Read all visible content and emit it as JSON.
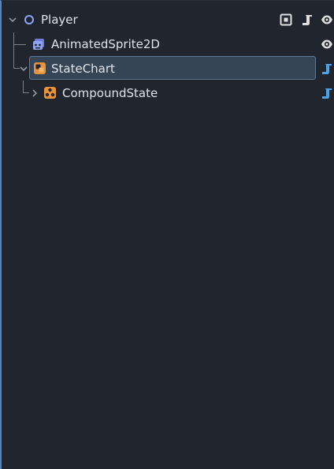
{
  "tree": {
    "nodes": [
      {
        "label": "Player",
        "icon": "node-circle-icon",
        "expanded": true
      },
      {
        "label": "AnimatedSprite2D",
        "icon": "animated-sprite-2d-icon"
      },
      {
        "label": "StateChart",
        "icon": "state-chart-icon",
        "expanded": true,
        "selected": true
      },
      {
        "label": "CompoundState",
        "icon": "compound-state-icon",
        "expanded": false
      }
    ]
  },
  "colors": {
    "background": "#21262e",
    "selection": "#364555",
    "selection_border": "#5c7894",
    "accent_blue": "#5586c4",
    "script_icon": "#4aa3e8",
    "state_orange": "#e8923a",
    "text": "#dfe4ea"
  }
}
